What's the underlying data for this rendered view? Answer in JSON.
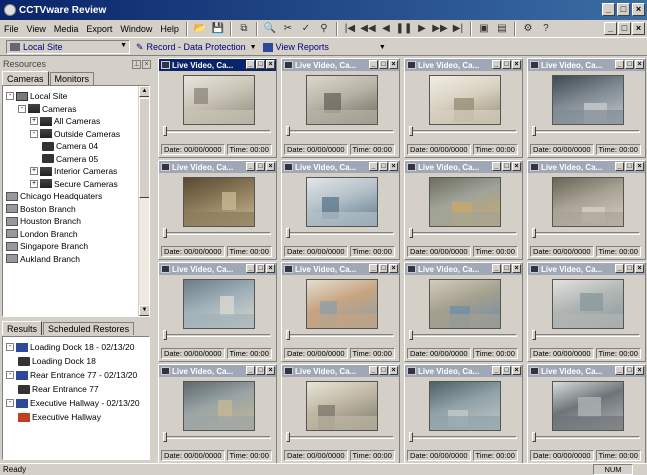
{
  "window": {
    "title": "CCTVware Review",
    "minimize": "_",
    "maximize": "□",
    "close": "×"
  },
  "menu": [
    "File",
    "View",
    "Media",
    "Export",
    "Window",
    "Help"
  ],
  "toolbar_icons": [
    "open-icon",
    "save-icon",
    "copy-icon",
    "zoom-icon",
    "check-icon",
    "binoculars-icon",
    "first-frame-icon",
    "rewind-icon",
    "step-back-icon",
    "pause-icon",
    "play-icon",
    "fast-forward-icon",
    "last-frame-icon",
    "camera-icon",
    "export-icon",
    "settings-icon",
    "help-icon"
  ],
  "toolbar2": {
    "site_combo": "Local Site",
    "record_button": "Record - Data Protection",
    "reports_button": "View Reports"
  },
  "resources": {
    "header": "Resources",
    "tabs": [
      "Cameras",
      "Monitors"
    ],
    "tree": [
      {
        "label": "Local Site",
        "depth": 0,
        "icon": "site-icon",
        "exp": "-"
      },
      {
        "label": "Cameras",
        "depth": 1,
        "icon": "camera-group-icon",
        "exp": "-"
      },
      {
        "label": "All Cameras",
        "depth": 2,
        "icon": "camera-group-icon",
        "exp": "+"
      },
      {
        "label": "Outside Cameras",
        "depth": 2,
        "icon": "camera-group-icon",
        "exp": "-"
      },
      {
        "label": "Camera 04",
        "depth": 3,
        "icon": "camera-icon",
        "exp": ""
      },
      {
        "label": "Camera 05",
        "depth": 3,
        "icon": "camera-icon",
        "exp": ""
      },
      {
        "label": "Interior Cameras",
        "depth": 2,
        "icon": "camera-group-icon",
        "exp": "+"
      },
      {
        "label": "Secure Cameras",
        "depth": 2,
        "icon": "camera-group-icon",
        "exp": "+"
      },
      {
        "label": "Chicago Headquaters",
        "depth": 0,
        "icon": "branch-icon",
        "exp": ""
      },
      {
        "label": "Boston Branch",
        "depth": 0,
        "icon": "branch-icon",
        "exp": ""
      },
      {
        "label": "Houston Branch",
        "depth": 0,
        "icon": "branch-icon",
        "exp": ""
      },
      {
        "label": "London Branch",
        "depth": 0,
        "icon": "branch-icon",
        "exp": ""
      },
      {
        "label": "Singapore Branch",
        "depth": 0,
        "icon": "branch-icon",
        "exp": ""
      },
      {
        "label": "Aukland Branch",
        "depth": 0,
        "icon": "branch-icon",
        "exp": ""
      }
    ]
  },
  "results": {
    "tabs": [
      "Results",
      "Scheduled Restores"
    ],
    "tree": [
      {
        "label": "Loading Dock 18 - 02/13/20",
        "depth": 0,
        "icon": "result-icon",
        "exp": "-"
      },
      {
        "label": "Loading Dock 18",
        "depth": 1,
        "icon": "camera-icon",
        "exp": ""
      },
      {
        "label": "Rear Entrance 77 - 02/13/20",
        "depth": 0,
        "icon": "result-icon",
        "exp": "-"
      },
      {
        "label": "Rear Entrance 77",
        "depth": 1,
        "icon": "camera-icon",
        "exp": ""
      },
      {
        "label": "Executive Hallway - 02/13/20",
        "depth": 0,
        "icon": "result-icon",
        "exp": "-"
      },
      {
        "label": "Executive Hallway",
        "depth": 1,
        "icon": "camera-alert-icon",
        "exp": ""
      }
    ]
  },
  "tiles": {
    "title": "Live Video, Ca...",
    "date_text": "Date: 00/00/0000",
    "time_text": "Time: 00:00",
    "count": 16
  },
  "status": {
    "text": "Ready",
    "num": "NUM"
  },
  "colors": {
    "titlebar": "#0a246a",
    "face": "#d4d0c8",
    "inactive_tile_title": "#a0a8b8"
  }
}
